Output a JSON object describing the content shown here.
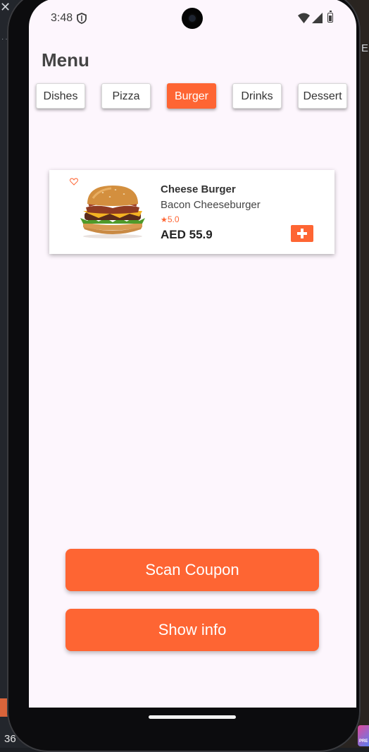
{
  "status_bar": {
    "time": "3:48"
  },
  "page_title": "Menu",
  "tabs": [
    {
      "label": "Dishes",
      "active": false
    },
    {
      "label": "Pizza",
      "active": false
    },
    {
      "label": "Burger",
      "active": true
    },
    {
      "label": "Drinks",
      "active": false
    },
    {
      "label": "Dessert",
      "active": false
    }
  ],
  "item": {
    "name": "Cheese Burger",
    "description": "Bacon Cheeseburger",
    "rating": "5.0",
    "price": "AED 55.9"
  },
  "buttons": {
    "scan_coupon": "Scan Coupon",
    "show_info": "Show info"
  },
  "desktop": {
    "letter": "E",
    "bottom_text": "36",
    "badge_text": "PRE"
  },
  "colors": {
    "accent": "#fe6533",
    "screen_bg": "#fdf6fd"
  }
}
